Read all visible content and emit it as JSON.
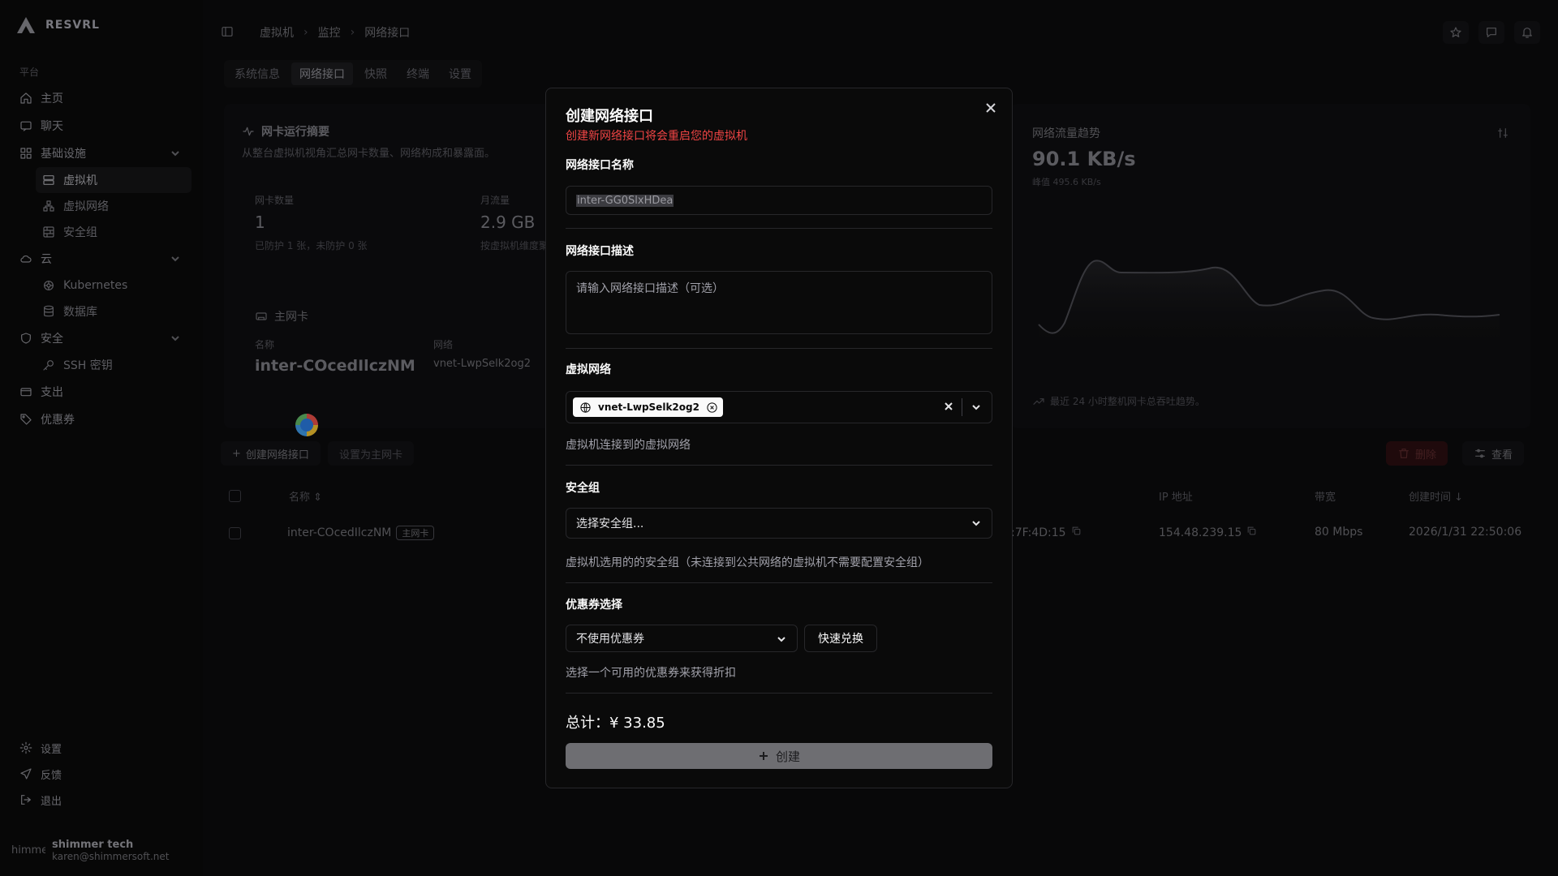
{
  "app": {
    "brand": "RESVRL"
  },
  "sidebar": {
    "section_label": "平台",
    "items": [
      {
        "label": "主页",
        "icon": "home-icon"
      },
      {
        "label": "聊天",
        "icon": "chat-icon"
      },
      {
        "label": "基础设施",
        "icon": "grid-icon"
      },
      {
        "label": "虚拟机",
        "icon": "server-icon"
      },
      {
        "label": "虚拟网络",
        "icon": "network-icon"
      },
      {
        "label": "安全组",
        "icon": "firewall-icon"
      },
      {
        "label": "云",
        "icon": "cloud-icon"
      },
      {
        "label": "Kubernetes",
        "icon": "kubernetes-icon"
      },
      {
        "label": "数据库",
        "icon": "database-icon"
      },
      {
        "label": "安全",
        "icon": "shield-icon"
      },
      {
        "label": "SSH 密钥",
        "icon": "key-icon"
      },
      {
        "label": "支出",
        "icon": "wallet-icon"
      },
      {
        "label": "优惠券",
        "icon": "tag-icon"
      }
    ],
    "bottom": [
      {
        "label": "设置",
        "icon": "gear-icon"
      },
      {
        "label": "反馈",
        "icon": "send-icon"
      },
      {
        "label": "退出",
        "icon": "logout-icon"
      }
    ],
    "user": {
      "avatar_text": "himme",
      "name": "shimmer tech",
      "email": "karen@shimmersoft.net"
    }
  },
  "header": {
    "breadcrumb": [
      "虚拟机",
      "监控",
      "网络接口"
    ]
  },
  "tabs": [
    "系统信息",
    "网络接口",
    "快照",
    "终端",
    "设置"
  ],
  "summary": {
    "title": "网卡运行摘要",
    "subtitle": "从整台虚拟机视角汇总网卡数量、网络构成和暴露面。",
    "nic_count_label": "网卡数量",
    "nic_count_value": "1",
    "nic_count_note": "已防护 1 张，未防护 0 张",
    "traffic_label": "月流量",
    "traffic_value": "2.9 GB",
    "traffic_note": "按虚拟机维度聚",
    "primary_nic_title": "主网卡",
    "name_label": "名称",
    "network_label": "网络",
    "nic_name": "inter-COcedIlczNM",
    "nic_network": "vnet-LwpSelk2og2"
  },
  "traffic": {
    "title": "网络流量趋势",
    "value": "90.1 KB/s",
    "peak": "峰值 495.6 KB/s",
    "footer": "最近 24 小时整机网卡总吞吐趋势。"
  },
  "toolbar": {
    "create_label": "创建网络接口",
    "set_primary_label": "设置为主网卡",
    "delete_label": "删除",
    "view_label": "查看"
  },
  "table": {
    "headers": {
      "name": "名称",
      "ip": "IP 地址",
      "bandwidth": "带宽",
      "created": "创建时间"
    },
    "rows": [
      {
        "name": "inter-COcedIlczNM",
        "badge": "主网卡",
        "mac_tail": ":7F:4D:15",
        "ip": "154.48.239.15",
        "bandwidth": "80 Mbps",
        "created": "2026/1/31 22:50:06"
      }
    ]
  },
  "modal": {
    "title": "创建网络接口",
    "warning": "创建新网络接口将会重启您的虚拟机",
    "name_label": "网络接口名称",
    "name_value": "inter-GG0SlxHDea",
    "desc_label": "网络接口描述",
    "desc_placeholder": "请输入网络接口描述（可选）",
    "vnet_label": "虚拟网络",
    "vnet_chip": "vnet-LwpSelk2og2",
    "vnet_help": "虚拟机连接到的虚拟网络",
    "sg_label": "安全组",
    "sg_placeholder": "选择安全组...",
    "sg_help": "虚拟机选用的的安全组（未连接到公共网络的虚拟机不需要配置安全组）",
    "coupon_label": "优惠券选择",
    "coupon_value": "不使用优惠券",
    "redeem_label": "快速兑换",
    "coupon_help": "选择一个可用的优惠券来获得折扣",
    "total_label": "总计：¥ 33.85",
    "create_label": "创建"
  },
  "colors": {
    "warning": "#ef4444",
    "background": "#0b0b0c",
    "modal_border": "#27272a"
  }
}
